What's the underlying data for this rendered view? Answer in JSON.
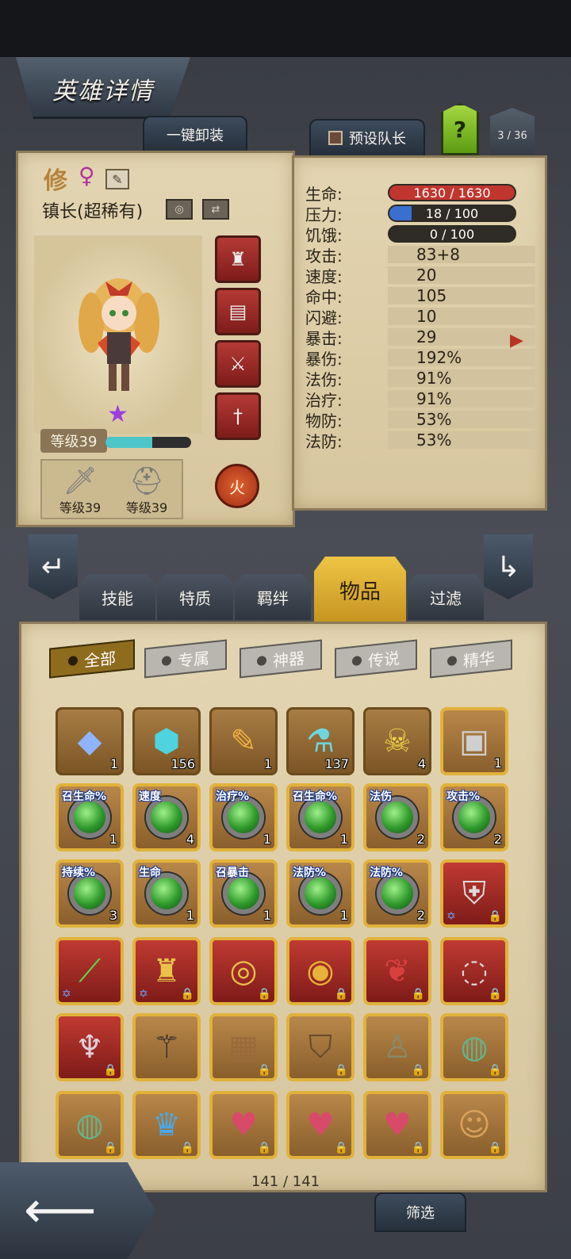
{
  "header": {
    "title": "英雄详情",
    "unequip_all": "一键卸装",
    "preset_leader": "预设队长",
    "help": "?",
    "hero_count": "3 / 36"
  },
  "hero": {
    "name": "修",
    "gender_symbol": "♀",
    "class_rarity": "镇长(超稀有)",
    "level_label": "等级39",
    "xp_fraction": 0.55,
    "equipped": [
      {
        "icon": "sword-icon",
        "level": "等级39"
      },
      {
        "icon": "helmet-icon",
        "level": "等级39"
      }
    ],
    "element": "火",
    "gear_slots": [
      "armor-icon",
      "book-icon",
      "claw-weapon-icon",
      "dagger-icon"
    ]
  },
  "stats": {
    "hp": {
      "label": "生命:",
      "value": "1630 / 1630",
      "fraction": 1.0,
      "color": "#c0362f"
    },
    "stress": {
      "label": "压力:",
      "value": "18 / 100",
      "fraction": 0.18,
      "color": "#3a6fd0"
    },
    "hunger": {
      "label": "饥饿:",
      "value": "0 / 100",
      "fraction": 0.0,
      "color": "#d0a030"
    },
    "rows": [
      {
        "label": "攻击:",
        "value": "83+8"
      },
      {
        "label": "速度:",
        "value": "20"
      },
      {
        "label": "命中:",
        "value": "105"
      },
      {
        "label": "闪避:",
        "value": "10"
      },
      {
        "label": "暴击:",
        "value": "29"
      },
      {
        "label": "暴伤:",
        "value": "192%"
      },
      {
        "label": "法伤:",
        "value": "91%"
      },
      {
        "label": "治疗:",
        "value": "91%"
      },
      {
        "label": "物防:",
        "value": "53%"
      },
      {
        "label": "法防:",
        "value": "53%"
      }
    ]
  },
  "tabs": [
    {
      "label": "技能",
      "active": false
    },
    {
      "label": "特质",
      "active": false
    },
    {
      "label": "羁绊",
      "active": false
    },
    {
      "label": "物品",
      "active": true
    },
    {
      "label": "过滤",
      "active": false
    }
  ],
  "filters": [
    {
      "label": "全部",
      "active": true
    },
    {
      "label": "专属",
      "active": false
    },
    {
      "label": "神器",
      "active": false
    },
    {
      "label": "传说",
      "active": false
    },
    {
      "label": "精华",
      "active": false
    }
  ],
  "inventory": {
    "count_text": "141 / 141",
    "rows": [
      [
        {
          "icon": "crystal-pile-icon",
          "glyph": "◆",
          "count": "1",
          "style": "plain",
          "color": "#8fb4ff"
        },
        {
          "icon": "rune-stone-icon",
          "glyph": "⬢",
          "count": "156",
          "style": "plain",
          "color": "#4ed3df"
        },
        {
          "icon": "feather-icon",
          "glyph": "✎",
          "count": "1",
          "style": "plain",
          "color": "#f0b040"
        },
        {
          "icon": "potion-icon",
          "glyph": "⚗",
          "count": "137",
          "style": "plain",
          "color": "#6fd6e0"
        },
        {
          "icon": "skull-totem-icon",
          "glyph": "☠",
          "count": "4",
          "style": "plain",
          "color": "#f0d24a"
        },
        {
          "icon": "treasure-chest-icon",
          "glyph": "▣",
          "count": "1",
          "style": "gold",
          "color": "#cfcfcf"
        }
      ],
      [
        {
          "icon": "gem-icon",
          "label": "召生命%",
          "count": "1",
          "style": "gold"
        },
        {
          "icon": "gem-icon",
          "label": "速度",
          "count": "4",
          "style": "gold"
        },
        {
          "icon": "gem-icon",
          "label": "治疗%",
          "count": "1",
          "style": "gold"
        },
        {
          "icon": "gem-icon",
          "label": "召生命%",
          "count": "1",
          "style": "gold"
        },
        {
          "icon": "gem-icon",
          "label": "法伤",
          "count": "2",
          "style": "gold"
        },
        {
          "icon": "gem-icon",
          "label": "攻击%",
          "count": "2",
          "style": "gold"
        }
      ],
      [
        {
          "icon": "gem-icon",
          "label": "持续%",
          "count": "3",
          "style": "gold"
        },
        {
          "icon": "gem-icon",
          "label": "生命",
          "count": "1",
          "style": "gold"
        },
        {
          "icon": "gem-icon",
          "label": "召暴击",
          "count": "1",
          "style": "gold"
        },
        {
          "icon": "gem-icon",
          "label": "法防%",
          "count": "1",
          "style": "gold"
        },
        {
          "icon": "gem-icon",
          "label": "法防%",
          "count": "2",
          "style": "gold"
        },
        {
          "icon": "shield-crest-icon",
          "glyph": "⛨",
          "style": "red",
          "locked": true,
          "starred": true,
          "color": "#dcdcdc"
        }
      ],
      [
        {
          "icon": "green-blade-icon",
          "glyph": "⟋",
          "style": "red",
          "locked": false,
          "starred": true,
          "color": "#5cd84a"
        },
        {
          "icon": "golden-helm-icon",
          "glyph": "♜",
          "style": "red",
          "locked": true,
          "starred": true,
          "color": "#e8c24a"
        },
        {
          "icon": "purple-ring-icon",
          "glyph": "◎",
          "style": "red",
          "locked": true,
          "color": "#e8c24a"
        },
        {
          "icon": "jeweled-ring-icon",
          "glyph": "◉",
          "style": "red",
          "locked": true,
          "color": "#e8b23a"
        },
        {
          "icon": "red-cloak-icon",
          "glyph": "❦",
          "style": "red",
          "locked": true,
          "color": "#d84040"
        },
        {
          "icon": "silver-ring-icon",
          "glyph": "◌",
          "style": "red",
          "locked": true,
          "color": "#d8d8d8"
        }
      ],
      [
        {
          "icon": "chalice-icon",
          "glyph": "♆",
          "style": "red",
          "locked": true,
          "color": "#e0d0d8"
        },
        {
          "icon": "dark-staff-icon",
          "glyph": "⚚",
          "style": "gold",
          "locked": false,
          "color": "#2a2a2a"
        },
        {
          "icon": "leather-armor-icon",
          "glyph": "▦",
          "style": "gold",
          "locked": true,
          "color": "#9a6a3a"
        },
        {
          "icon": "wooden-shield-icon",
          "glyph": "⛉",
          "style": "gold",
          "locked": true,
          "color": "#6a4a2a"
        },
        {
          "icon": "hood-helm-icon",
          "glyph": "♙",
          "style": "gold",
          "locked": true,
          "color": "#8a8a6a"
        },
        {
          "icon": "jade-ring-icon",
          "glyph": "◍",
          "style": "gold",
          "locked": true,
          "color": "#6ab08a"
        }
      ],
      [
        {
          "icon": "emerald-ring-icon",
          "glyph": "◍",
          "style": "gold",
          "locked": true,
          "color": "#6ab08a"
        },
        {
          "icon": "crystal-helm-icon",
          "glyph": "♛",
          "style": "gold",
          "locked": true,
          "color": "#4aa8e8"
        },
        {
          "icon": "heart-axe-icon",
          "glyph": "♥",
          "style": "gold",
          "locked": true,
          "color": "#d84a6a"
        },
        {
          "icon": "heart-axe-icon",
          "glyph": "♥",
          "style": "gold",
          "locked": true,
          "color": "#d84a6a"
        },
        {
          "icon": "heart-axe-icon",
          "glyph": "♥",
          "style": "gold",
          "locked": true,
          "color": "#d84a6a"
        },
        {
          "icon": "voodoo-doll-icon",
          "glyph": "☺",
          "style": "gold",
          "locked": true,
          "color": "#d8a05a"
        }
      ]
    ]
  },
  "footer": {
    "back_arrow": "⟵",
    "sort": "筛选"
  }
}
